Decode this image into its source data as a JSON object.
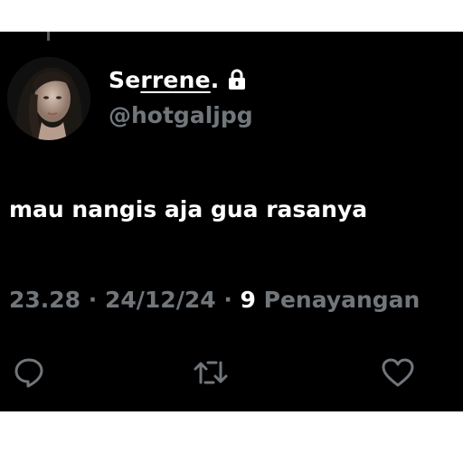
{
  "tweet": {
    "author": {
      "display_name_initial": "Se",
      "display_name_rest": "rrene",
      "display_name_end": ".",
      "handle": "@hotgaljpg",
      "protected_icon": "lock-icon"
    },
    "text": "mau nangis aja gua rasanya",
    "meta": {
      "time": "23.28",
      "separator": " · ",
      "date": "24/12/24",
      "views_count": "9",
      "views_label": " Penayangan"
    },
    "actions": {
      "reply_icon": "reply-icon",
      "retweet_icon": "retweet-icon",
      "like_icon": "heart-icon"
    }
  },
  "colors": {
    "background": "#000000",
    "text_primary": "#ffffff",
    "text_secondary": "#71767b"
  }
}
